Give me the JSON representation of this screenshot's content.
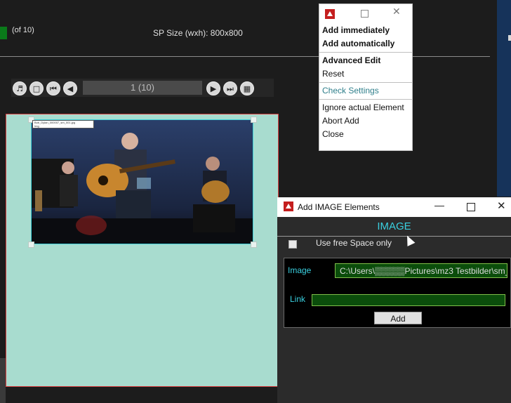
{
  "header": {
    "of_count": "(of 10)",
    "sp_size": "SP Size (wxh): 800x800"
  },
  "nav": {
    "page": "1 (10)",
    "icons": [
      "speaker-icon",
      "window-icon",
      "first-page-icon",
      "prev-page-icon",
      "next-page-icon",
      "last-page-icon",
      "grid-icon"
    ]
  },
  "canvas": {
    "photo_label": "Bob_Dylan_000007_sm_001.jpg",
    "photo_label_sub": "Img"
  },
  "context_menu": {
    "items": [
      {
        "label": "Add immediately"
      },
      {
        "label": "Add automatically"
      },
      {
        "label": "Advanced Edit"
      },
      {
        "label": "Reset"
      },
      {
        "label": "Check Settings"
      },
      {
        "label": "Ignore actual Element"
      },
      {
        "label": "Abort Add"
      },
      {
        "label": "Close"
      }
    ]
  },
  "dialog": {
    "title": "Add IMAGE Elements",
    "header": "IMAGE",
    "use_free_space": "Use free Space only",
    "image_label": "Image",
    "image_value": "C:\\Users\\▒▒▒▒▒Pictures\\mz3 Testbilder\\sm_",
    "link_label": "Link",
    "link_value": "",
    "add_label": "Add"
  },
  "colors": {
    "accent_teal": "#3ad0e0",
    "canvas_fill": "#a8dccf",
    "input_green": "#0b4d0b",
    "brand_red": "#c41e1e"
  }
}
